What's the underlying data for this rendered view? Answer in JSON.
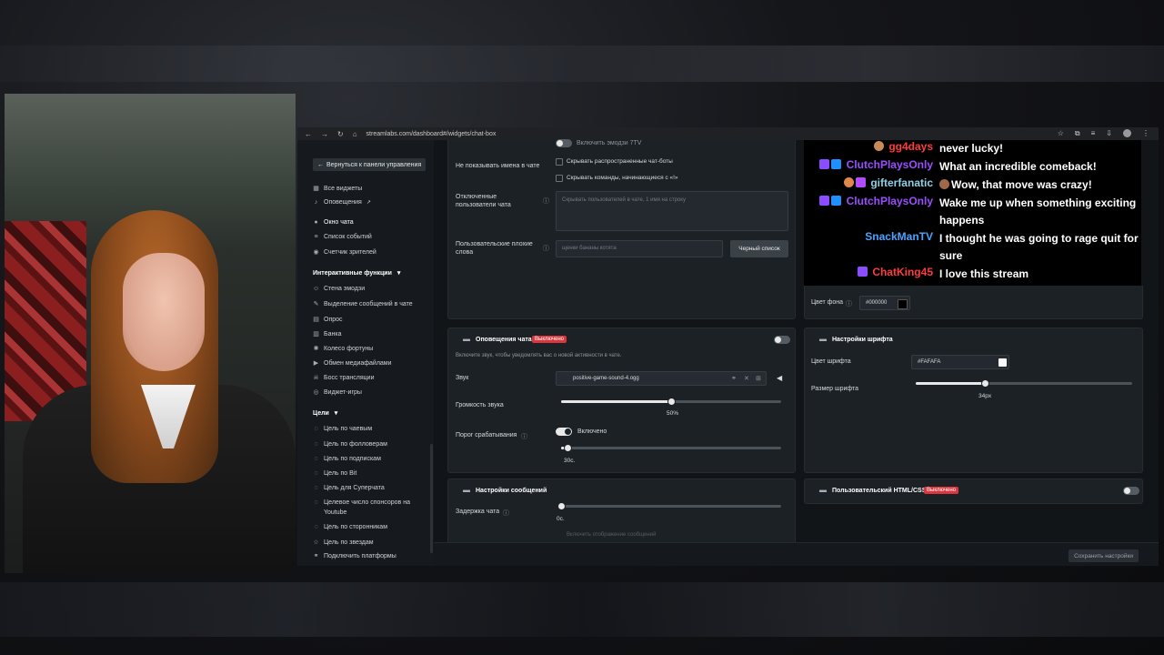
{
  "browser": {
    "url": "streamlabs.com/dashboard#/widgets/chat-box"
  },
  "sidebar": {
    "back_label": "Вернуться к панели управления",
    "items_top": [
      {
        "label": "Все виджеты",
        "icon": "grid-icon"
      },
      {
        "label": "Оповещения",
        "icon": "bell-icon"
      },
      {
        "label": "Окно чата",
        "icon": "chat-icon",
        "active": true
      },
      {
        "label": "Список событий",
        "icon": "list-icon"
      },
      {
        "label": "Счетчик зрителей",
        "icon": "eye-icon"
      }
    ],
    "section_interactive": "Интерактивные функции",
    "items_interactive": [
      {
        "label": "Стена эмодзи"
      },
      {
        "label": "Выделение сообщений в чате"
      },
      {
        "label": "Опрос"
      },
      {
        "label": "Банка"
      },
      {
        "label": "Колесо фортуны"
      },
      {
        "label": "Обмен медиафайлами"
      },
      {
        "label": "Босс трансляции"
      },
      {
        "label": "Виджет-игры"
      }
    ],
    "section_goals": "Цели",
    "items_goals": [
      {
        "label": "Цель по чаевым"
      },
      {
        "label": "Цель по фолловерам"
      },
      {
        "label": "Цель по подпискам"
      },
      {
        "label": "Цель по Bit"
      },
      {
        "label": "Цель для Суперчата"
      },
      {
        "label": "Целевое число спонсоров на"
      },
      {
        "label": "Youtube"
      },
      {
        "label": "Цель по сторонникам"
      },
      {
        "label": "Цель по звездам"
      },
      {
        "label": "Подключить платформы"
      }
    ]
  },
  "settings_top": {
    "emoji_partial": "Включить эмодзи 7TV",
    "hide_names_label": "Не показывать имена в чате",
    "hide_bots": "Скрывать распространенные чат-боты",
    "hide_commands": "Скрывать команды, начинающиеся с «!»",
    "muted_users_label_1": "Отключенные",
    "muted_users_label_2": "пользователи чата",
    "muted_users_placeholder": "Скрывать пользователей в чате, 1 имя на строку",
    "bad_words_label_1": "Пользовательские плохие",
    "bad_words_label_2": "слова",
    "bad_words_placeholder": "щенки бананы котята",
    "blacklist_button": "Черный список"
  },
  "chat_preview": {
    "messages": [
      {
        "name": "gg4days",
        "name_color": "#ff3b3b",
        "text": "never lucky!"
      },
      {
        "name": "ClutchPlaysOnly",
        "name_color": "#9b4dff",
        "text": "What an incredible comeback!"
      },
      {
        "name": "gifterfanatic",
        "name_color": "#8fd0e6",
        "text": "Wow, that move was crazy!"
      },
      {
        "name": "ClutchPlaysOnly",
        "name_color": "#9b4dff",
        "text": "Wake me up when something exciting happens"
      },
      {
        "name": "SnackManTV",
        "name_color": "#4aa3ff",
        "text": "I thought he was going to rage quit for sure"
      },
      {
        "name": "ChatKing45",
        "name_color": "#ff3b3b",
        "text": "I love this stream"
      }
    ]
  },
  "bg_color": {
    "label": "Цвет фона",
    "value": "#000000"
  },
  "chat_alerts": {
    "title": "Оповещения чата",
    "status": "Выключено",
    "description": "Включите звук, чтобы уведомлять вас о новой активности в чате.",
    "sound_label": "Звук",
    "sound_file": "positive-game-sound-4.ogg",
    "volume_label": "Громкость звука",
    "volume_value": "50%",
    "volume_fraction": 0.5,
    "threshold_label": "Порог срабатывания",
    "threshold_toggle_label": "Включено",
    "threshold_value": "30с.",
    "threshold_fraction": 0.03
  },
  "font_settings": {
    "title": "Настройки шрифта",
    "color_label": "Цвет шрифта",
    "color_value": "#FAFAFA",
    "size_label": "Размер шрифта",
    "size_value": "34px",
    "size_fraction": 0.32
  },
  "message_settings": {
    "title": "Настройки сообщений",
    "delay_label": "Задержка чата",
    "delay_value": "0с.",
    "delay_fraction": 0,
    "cut_off_text": "Включить отображение сообщений"
  },
  "custom_html": {
    "title": "Пользовательский HTML/CSS",
    "status": "Выключено"
  },
  "save_button": "Сохранить настройки"
}
